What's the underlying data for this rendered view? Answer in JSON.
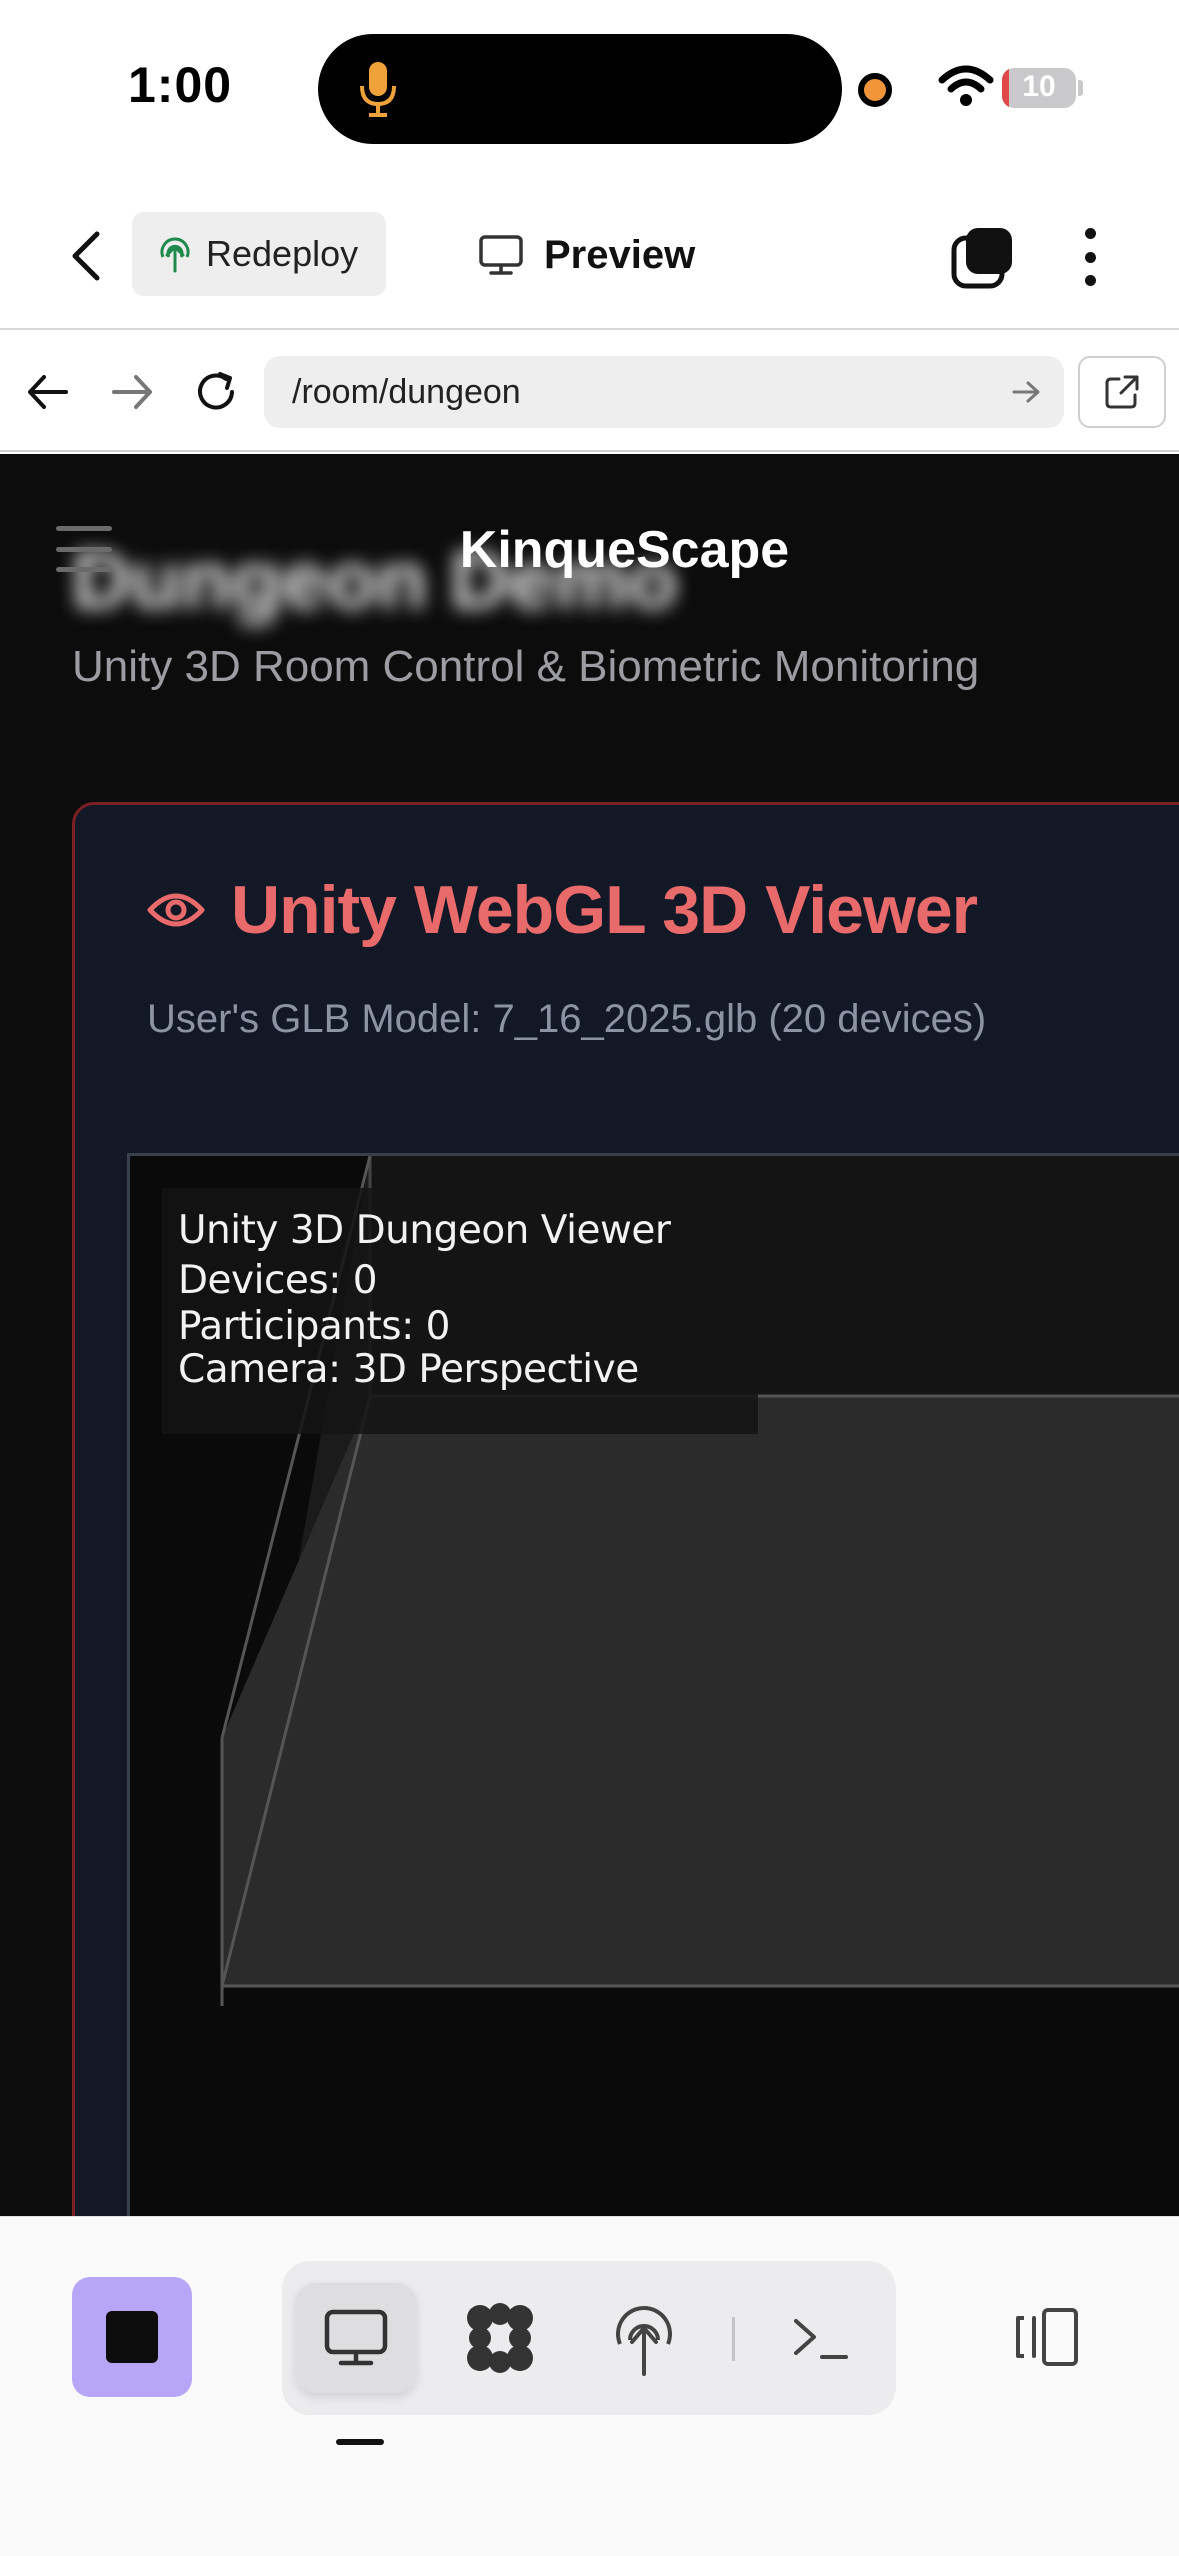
{
  "status_bar": {
    "time": "1:00",
    "battery_level": "10",
    "battery_fraction": 0.1
  },
  "app_header": {
    "redeploy_label": "Redeploy",
    "preview_label": "Preview"
  },
  "browser": {
    "url": "/room/dungeon"
  },
  "page": {
    "blurred_heading": "Dungeon Demo",
    "site_title": "KinqueScape",
    "subtitle": "Unity 3D Room Control & Biometric Monitoring",
    "viewer_card": {
      "title": "Unity WebGL 3D Viewer",
      "subtitle": "User's GLB Model: 7_16_2025.glb (20 devices)",
      "overlay": {
        "line1": "Unity 3D Dungeon Viewer",
        "line2": "Devices: 0",
        "line3": "Participants: 0",
        "line4": "Camera: 3D Perspective"
      }
    }
  },
  "colors": {
    "accent_red": "#e86a6a",
    "card_border": "#7a1f24",
    "stop_button": "#b7a6f7",
    "page_bg": "#0c0c0c"
  },
  "bottom_bar": {
    "items": [
      "stop-icon",
      "monitor-icon",
      "workspace-icon",
      "deploy-icon",
      "terminal-icon",
      "panel-toggle-icon"
    ],
    "active_item": "monitor-icon"
  }
}
